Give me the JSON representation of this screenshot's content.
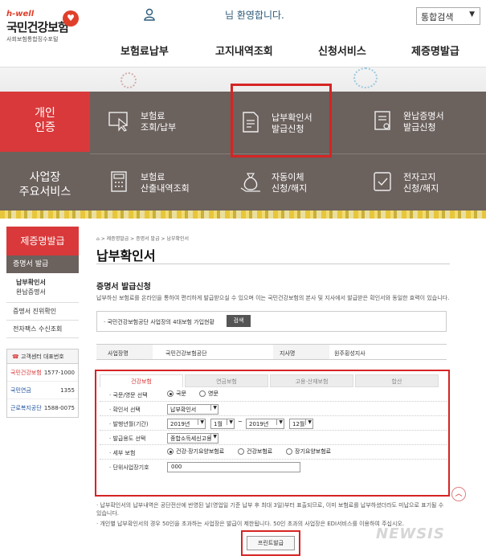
{
  "header": {
    "logo_tag": "h-well",
    "logo_name": "국민건강보험",
    "logo_sub": "사회보험통합징수포털",
    "welcome": "님 환영합니다.",
    "search_select": "통합검색",
    "gnb": [
      "보험료납부",
      "고지내역조회",
      "신청서비스",
      "제증명발급"
    ]
  },
  "quick": {
    "personal": [
      "개인",
      "인증"
    ],
    "business": [
      "사업장",
      "주요서비스"
    ],
    "items": [
      {
        "l1": "보험료",
        "l2": "조회/납부"
      },
      {
        "l1": "납부확인서",
        "l2": "발급신청"
      },
      {
        "l1": "완납증명서",
        "l2": "발급신청"
      },
      {
        "l1": "보험료",
        "l2": "산출내역조회"
      },
      {
        "l1": "자동이체",
        "l2": "신청/해지"
      },
      {
        "l1": "전자고지",
        "l2": "신청/해지"
      }
    ]
  },
  "lnb": {
    "title": "제증명발급",
    "selected": "증명서 발급",
    "subs": [
      "납부확인서",
      "완납증명서"
    ],
    "items": [
      "증명서 진위확인",
      "전자팩스 수신조회"
    ],
    "contact_title": "고객센터 대표번호",
    "contacts": [
      {
        "org": "국민건강보험",
        "num": "1577-1000"
      },
      {
        "org": "국민연금",
        "num": "1355"
      },
      {
        "org": "근로복지공단",
        "num": "1588-0075"
      }
    ]
  },
  "main": {
    "breadcrumb": "⌂ > 제증명발급 > 증명서 발급 > 납부확인서",
    "title": "납부확인서",
    "section": "증명서 발급신청",
    "desc": "납부하신 보험료를 온라인을 통하여 편리하게 발급받으실 수 있으며 이는 국민건강보험의 본사 및 지사에서 발급받은 확인서와 동일한 효력이 있습니다.",
    "info": "· 국민건강보험공단 사업장의 4대보험 가입현황",
    "search_btn": "검색",
    "biz_name_label": "사업장명",
    "biz_name": "국민건강보험공단",
    "branch_label": "지사명",
    "branch": "원주횡성지사",
    "tabs": [
      "건강보험",
      "연금보험",
      "고용·산재보험",
      "합산"
    ],
    "form": {
      "lang_label": "· 국문/영문 선택",
      "lang_opts": [
        "국문",
        "영문"
      ],
      "type_label": "· 확인서 선택",
      "type_value": "납부확인서",
      "period_label": "· 발행년월(기간)",
      "from_year": "2019년",
      "from_month": "1월",
      "tilde": "~",
      "to_year": "2019년",
      "to_month": "12월",
      "purpose_label": "· 발급용도 선택",
      "purpose_value": "종합소득세신고용",
      "detail_label": "· 세부 보험",
      "detail_opts": [
        "건강·장기요양보험료",
        "건강보험료",
        "장기요양보험료"
      ],
      "unit_label": "· 단위사업장기호",
      "unit_value": "000"
    },
    "notes": [
      "· 납부확인서의 납부내역은 공단전산에 반영된 날(영업일 기준 납부 후 최대 3일)부터 표출되므로, 이미 보험료를 납부하셨더라도 미납으로 표기될 수 있습니다.",
      "· 개인별 납부확인서의 경우 50인을 초과하는 사업장은 발급이 제한됩니다. 50인 초과의 사업장은 EDI서비스를 이용하여 주십시오."
    ],
    "print_btn": "프린트발급"
  },
  "watermark": "NEWSIS"
}
